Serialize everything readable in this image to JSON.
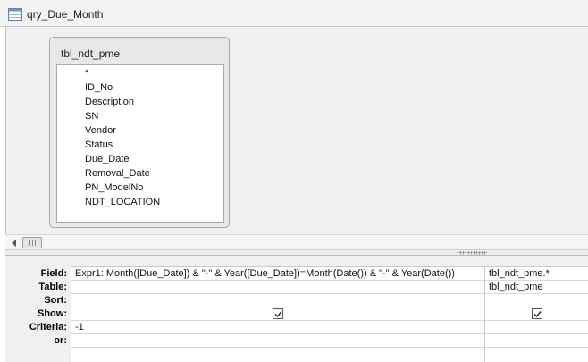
{
  "window": {
    "title": "qry_Due_Month",
    "icon": "query-icon"
  },
  "table": {
    "name": "tbl_ndt_pme",
    "fields": [
      "*",
      "ID_No",
      "Description",
      "SN",
      "Vendor",
      "Status",
      "Due_Date",
      "Removal_Date",
      "PN_ModelNo",
      "NDT_LOCATION"
    ]
  },
  "grid": {
    "row_labels": {
      "field": "Field:",
      "table": "Table:",
      "sort": "Sort:",
      "show": "Show:",
      "criteria": "Criteria:",
      "or": "or:"
    },
    "columns": [
      {
        "field": "Expr1: Month([Due_Date]) & \"-\" & Year([Due_Date])=Month(Date()) & \"-\" & Year(Date())",
        "table": "",
        "sort": "",
        "show": true,
        "criteria": "-1",
        "or": ""
      },
      {
        "field": "tbl_ndt_pme.*",
        "table": "tbl_ndt_pme",
        "sort": "",
        "show": true,
        "criteria": "",
        "or": ""
      }
    ]
  }
}
